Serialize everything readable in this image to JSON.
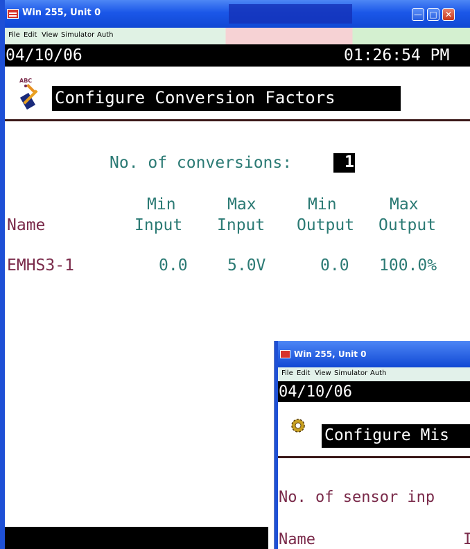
{
  "main_window": {
    "title": "Win 255, Unit 0",
    "menu": [
      "File",
      "Edit",
      "View",
      "Simulator",
      "Auth"
    ],
    "date": "04/10/06",
    "time": "01:26:54 PM",
    "icon_label": "ABC",
    "screen_title": "Configure Conversion Factors",
    "conversions_label": "No. of conversions:",
    "conversions_value": "1",
    "table": {
      "headers": {
        "name": "Name",
        "min_input": [
          "Min",
          "Input"
        ],
        "max_input": [
          "Max",
          "Input"
        ],
        "min_output": [
          "Min",
          "Output"
        ],
        "max_output": [
          "Max",
          "Output"
        ]
      },
      "rows": [
        {
          "name": "EMHS3-1",
          "min_input": "0.0",
          "max_input": "5.0V",
          "min_output": "0.0",
          "max_output": "100.0%"
        }
      ]
    }
  },
  "second_window": {
    "title": "Win 255, Unit 0",
    "menu": [
      "File",
      "Edit",
      "View",
      "Simulator",
      "Auth"
    ],
    "date": "04/10/06",
    "screen_title": "Configure Mis",
    "sensor_label": "No. of sensor inp",
    "name_header": "Name",
    "clipped_header": "I"
  },
  "colors": {
    "titlebar": "#1b57e8",
    "text_teal": "#2b7a74",
    "text_maroon": "#7a2a4a",
    "bar_black": "#000000"
  }
}
